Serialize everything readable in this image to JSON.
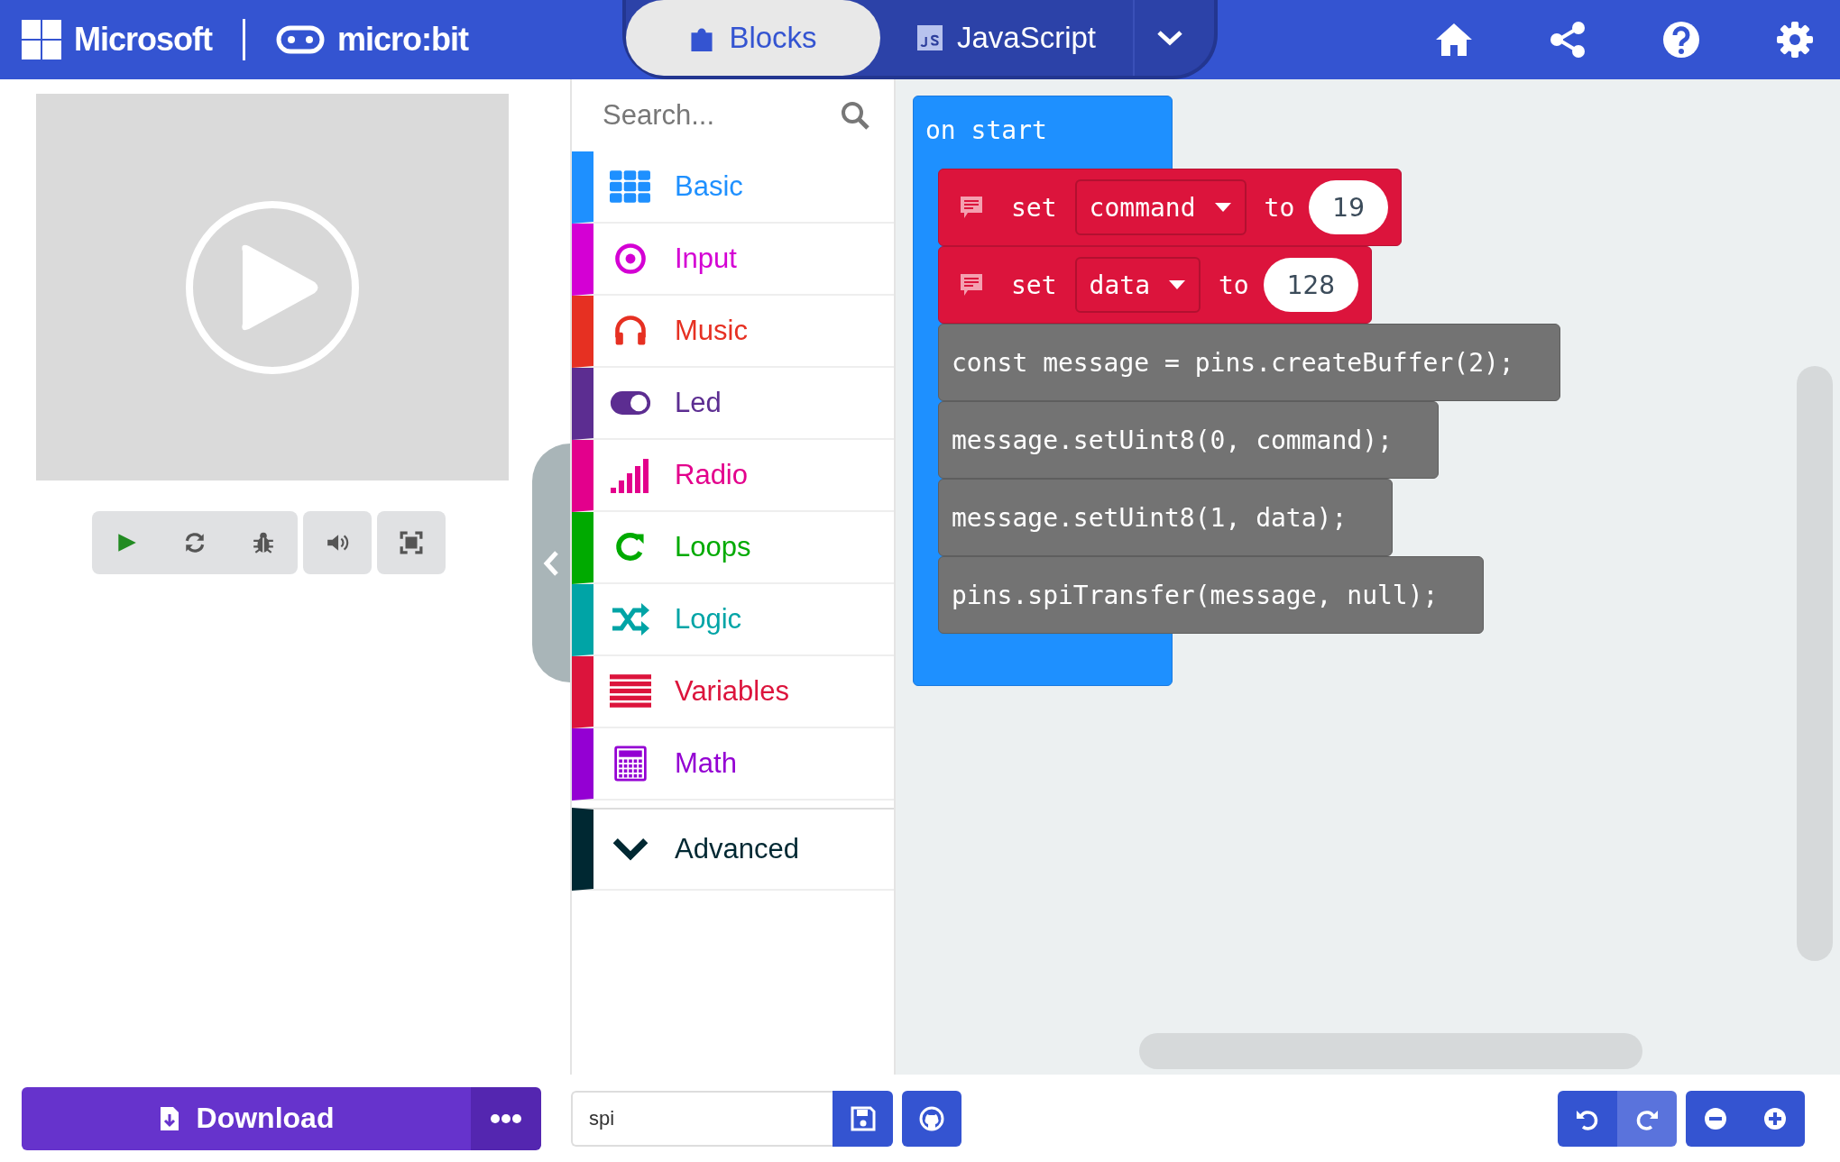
{
  "header": {
    "brand": "Microsoft",
    "product": "micro:bit",
    "tabs": [
      {
        "label": "Blocks",
        "selected": true,
        "kind": "blocks"
      },
      {
        "label": "JavaScript",
        "selected": false,
        "kind": "js"
      }
    ]
  },
  "simulator": {
    "controls": [
      {
        "kind": "play"
      },
      {
        "kind": "restart"
      },
      {
        "kind": "debug"
      },
      {
        "kind": "sound"
      },
      {
        "kind": "fullscreen"
      }
    ]
  },
  "toolbox": {
    "search": {
      "placeholder": "Search..."
    },
    "categories": [
      {
        "label": "Basic",
        "color": "#1e90ff",
        "kind": "grid"
      },
      {
        "label": "Input",
        "color": "#d400d4",
        "kind": "target"
      },
      {
        "label": "Music",
        "color": "#e63022",
        "kind": "headphones"
      },
      {
        "label": "Led",
        "color": "#5c2d91",
        "kind": "toggle"
      },
      {
        "label": "Radio",
        "color": "#e3008c",
        "kind": "signal"
      },
      {
        "label": "Loops",
        "color": "#00aa00",
        "kind": "loop"
      },
      {
        "label": "Logic",
        "color": "#00a4a6",
        "kind": "shuffle"
      },
      {
        "label": "Variables",
        "color": "#dc143c",
        "kind": "lines"
      },
      {
        "label": "Math",
        "color": "#9400d3",
        "kind": "calculator"
      }
    ],
    "advanced": {
      "label": "Advanced",
      "color": "#002832"
    }
  },
  "workspace": {
    "event": "on start",
    "statements": [
      {
        "kind": "set",
        "keyword": "set",
        "variable": "command",
        "to": "to",
        "value": "19"
      },
      {
        "kind": "set",
        "keyword": "set",
        "variable": "data",
        "to": "to",
        "value": "128"
      },
      {
        "kind": "code",
        "text": "const message = pins.createBuffer(2);"
      },
      {
        "kind": "code",
        "text": "message.setUint8(0, command);"
      },
      {
        "kind": "code",
        "text": "message.setUint8(1, data);"
      },
      {
        "kind": "code",
        "text": "pins.spiTransfer(message, null);"
      }
    ]
  },
  "footer": {
    "download": "Download",
    "project_name": "spi"
  }
}
